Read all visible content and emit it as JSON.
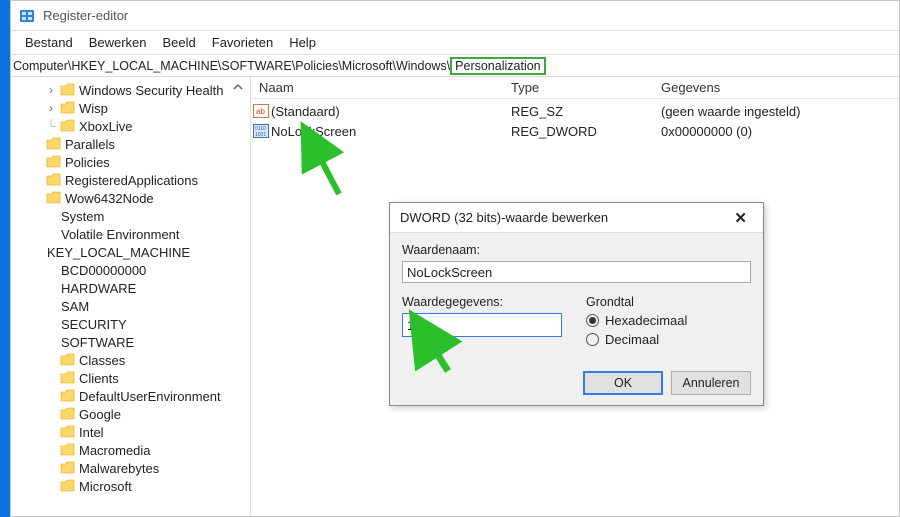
{
  "window": {
    "title": "Register-editor"
  },
  "menubar": {
    "items": [
      "Bestand",
      "Bewerken",
      "Beeld",
      "Favorieten",
      "Help"
    ]
  },
  "addressbar": {
    "prefix": "Computer\\HKEY_LOCAL_MACHINE\\SOFTWARE\\Policies\\Microsoft\\Windows\\",
    "last": "Personalization"
  },
  "tree": {
    "items": [
      {
        "expand": ">",
        "icon": true,
        "indent": 2,
        "label": "Windows Security Health"
      },
      {
        "expand": ">",
        "icon": true,
        "indent": 2,
        "label": "Wisp"
      },
      {
        "expand": "┗",
        "icon": true,
        "indent": 2,
        "label": "XboxLive"
      },
      {
        "expand": "",
        "icon": true,
        "indent": 1,
        "label": "Parallels"
      },
      {
        "expand": "",
        "icon": true,
        "indent": 1,
        "label": "Policies"
      },
      {
        "expand": "",
        "icon": true,
        "indent": 1,
        "label": "RegisteredApplications"
      },
      {
        "expand": "",
        "icon": true,
        "indent": 1,
        "label": "Wow6432Node"
      },
      {
        "expand": "",
        "icon": false,
        "indent": 1,
        "label": "System"
      },
      {
        "expand": "",
        "icon": false,
        "indent": 1,
        "label": "Volatile Environment"
      },
      {
        "expand": "",
        "icon": false,
        "indent": 0,
        "label": "KEY_LOCAL_MACHINE"
      },
      {
        "expand": "",
        "icon": false,
        "indent": 1,
        "label": "BCD00000000"
      },
      {
        "expand": "",
        "icon": false,
        "indent": 1,
        "label": "HARDWARE"
      },
      {
        "expand": "",
        "icon": false,
        "indent": 1,
        "label": "SAM"
      },
      {
        "expand": "",
        "icon": false,
        "indent": 1,
        "label": "SECURITY"
      },
      {
        "expand": "",
        "icon": false,
        "indent": 1,
        "label": "SOFTWARE"
      },
      {
        "expand": "",
        "icon": true,
        "indent": 2,
        "label": "Classes"
      },
      {
        "expand": "",
        "icon": true,
        "indent": 2,
        "label": "Clients"
      },
      {
        "expand": "",
        "icon": true,
        "indent": 2,
        "label": "DefaultUserEnvironment"
      },
      {
        "expand": "",
        "icon": true,
        "indent": 2,
        "label": "Google"
      },
      {
        "expand": "",
        "icon": true,
        "indent": 2,
        "label": "Intel"
      },
      {
        "expand": "",
        "icon": true,
        "indent": 2,
        "label": "Macromedia"
      },
      {
        "expand": "",
        "icon": true,
        "indent": 2,
        "label": "Malwarebytes"
      },
      {
        "expand": "",
        "icon": true,
        "indent": 2,
        "label": "Microsoft"
      }
    ]
  },
  "columns": {
    "name": "Naam",
    "type": "Type",
    "data": "Gegevens"
  },
  "values": [
    {
      "icon": "sz",
      "name": "(Standaard)",
      "type": "REG_SZ",
      "data": "(geen waarde ingesteld)"
    },
    {
      "icon": "dw",
      "name": "NoLockScreen",
      "type": "REG_DWORD",
      "data": "0x00000000 (0)"
    }
  ],
  "dialog": {
    "title": "DWORD (32 bits)-waarde bewerken",
    "name_label": "Waardenaam:",
    "name_value": "NoLockScreen",
    "data_label": "Waardegegevens:",
    "data_value": "1",
    "base_label": "Grondtal",
    "radio_hex": "Hexadecimaal",
    "radio_dec": "Decimaal",
    "ok": "OK",
    "cancel": "Annuleren"
  }
}
